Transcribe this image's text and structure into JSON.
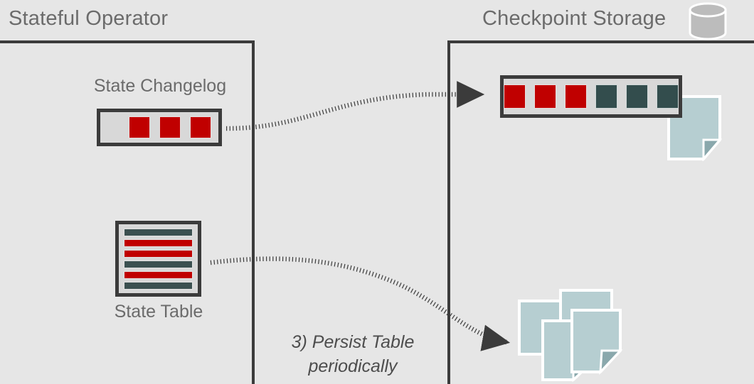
{
  "diagram": {
    "background_color": "#e6e6e6",
    "accent_red": "#c00000",
    "accent_teal": "#334d4d",
    "sheet_color": "#b6ced1",
    "frame_color": "#3b3b3b",
    "title_color": "#6b6b6b"
  },
  "left_panel": {
    "title": "Stateful Operator",
    "changelog": {
      "label": "State Changelog",
      "cells": [
        "red",
        "red",
        "red"
      ]
    },
    "state_table": {
      "label": "State Table",
      "rows": [
        "teal",
        "red",
        "red",
        "teal",
        "red",
        "teal"
      ]
    }
  },
  "right_panel": {
    "title": "Checkpoint Storage",
    "db_icon": "database-cylinder-icon",
    "storage_bar": {
      "cells": [
        "red",
        "red",
        "red",
        "teal",
        "teal",
        "teal"
      ]
    },
    "sheet_behind_bar": "document-page-icon",
    "document_stack": {
      "name": "document-stack-icon",
      "count": 4
    }
  },
  "caption": {
    "line1": "3) Persist Table",
    "line2": "periodically"
  },
  "arrows": [
    {
      "name": "changelog-to-storage-arrow",
      "style": "dotted-curved",
      "from": "State Changelog",
      "to": "Checkpoint Storage bar"
    },
    {
      "name": "state-table-to-documents-arrow",
      "style": "dotted-curved",
      "from": "State Table",
      "to": "Document stack"
    }
  ]
}
